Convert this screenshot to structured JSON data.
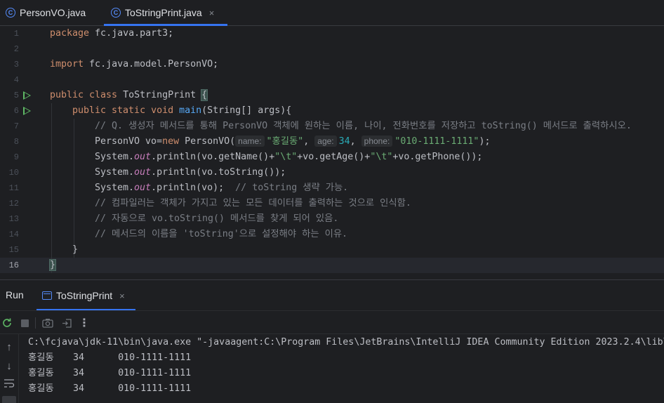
{
  "tabs": [
    {
      "label": "PersonVO.java",
      "icon": "class-icon",
      "active": false
    },
    {
      "label": "ToStringPrint.java",
      "icon": "class-icon",
      "active": true,
      "close": "×"
    }
  ],
  "class_icon_glyph": "C",
  "gutter": [
    "1",
    "2",
    "3",
    "4",
    "5",
    "6",
    "7",
    "8",
    "9",
    "10",
    "11",
    "12",
    "13",
    "14",
    "15",
    "16"
  ],
  "code": {
    "l1_kw": "package",
    "l1_rest": " fc.java.part3;",
    "l3_kw": "import",
    "l3_rest": " fc.java.model.PersonVO;",
    "l5_kw": "public class",
    "l5_name": " ToStringPrint ",
    "l5_brace": "{",
    "l6_kw": "public static void",
    "l6_fn": " main",
    "l6_rest": "(String[] args){",
    "l7_cmt": "// Q. 생성자 메서드를 통해 PersonVO 객체에 원하는 이름, 나이, 전화번호를 저장하고 toString() 메서드로 출력하시오.",
    "l8_a": "PersonVO vo=",
    "l8_new": "new",
    "l8_b": " PersonVO(",
    "l8_hint1": "name:",
    "l8_s1": "\"홍길동\"",
    "l8_c1": ", ",
    "l8_hint2": "age:",
    "l8_n": "34",
    "l8_c2": ", ",
    "l8_hint3": "phone:",
    "l8_s2": "\"010-1111-1111\"",
    "l8_end": ");",
    "l9_a": "System.",
    "l9_out": "out",
    "l9_b": ".println(vo.getName()+",
    "l9_s1": "\"\\t\"",
    "l9_c": "+vo.getAge()+",
    "l9_s2": "\"\\t\"",
    "l9_d": "+vo.getPhone());",
    "l10_a": "System.",
    "l10_out": "out",
    "l10_b": ".println(vo.toString());",
    "l11_a": "System.",
    "l11_out": "out",
    "l11_b": ".println(vo);  ",
    "l11_cmt": "// toString 생략 가능.",
    "l12_cmt": "// 컴파일러는 객체가 가지고 있는 모든 데이터를 출력하는 것으로 인식함.",
    "l13_cmt": "// 자동으로 vo.toString() 메서드를 찾게 되어 있음.",
    "l14_cmt": "// 메서드의 이름을 'toString'으로 설정해야 하는 이유.",
    "l15": "}",
    "l16": "}"
  },
  "run_panel": {
    "title": "Run",
    "tab_label": "ToStringPrint",
    "tab_close": "×"
  },
  "toolbar_icons": [
    "rerun-icon",
    "stop-icon",
    "camera-icon",
    "exit-icon",
    "more-icon"
  ],
  "side_icons": [
    "arrow-up-icon",
    "arrow-down-icon",
    "soft-wrap-icon",
    "scroll-end-icon"
  ],
  "console_lines": [
    "C:\\fcjava\\jdk-11\\bin\\java.exe \"-javaagent:C:\\Program Files\\JetBrains\\IntelliJ IDEA Community Edition 2023.2.4\\lib\\",
    "홍길동\t34\t010-1111-1111",
    "홍길동\t34\t010-1111-1111",
    "홍길동\t34\t010-1111-1111"
  ],
  "colors": {
    "background": "#1e1f22",
    "keyword": "#cf8e6d",
    "function": "#56a8f5",
    "string": "#6aab73",
    "number": "#2aacb8",
    "comment": "#7a7e85",
    "static_field": "#c77dbb",
    "accent": "#3574f0",
    "run_green": "#5fb865"
  }
}
